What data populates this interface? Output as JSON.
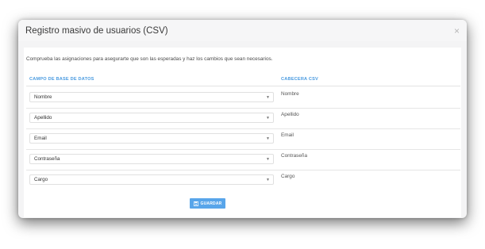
{
  "modal": {
    "title": "Registro masivo de usuarios (CSV)",
    "close": "×"
  },
  "description": "Comprueba las asignaciones para asegurarte que son las esperadas y haz los cambios que sean necesarios.",
  "columns": {
    "db_field": "CAMPO DE BASE DE DATOS",
    "csv_header": "CABECERA CSV"
  },
  "rows": [
    {
      "select": "Nombre",
      "csv": "Nombre"
    },
    {
      "select": "Apellido",
      "csv": "Apellido"
    },
    {
      "select": "Email",
      "csv": "Email"
    },
    {
      "select": "Contraseña",
      "csv": "Contraseña"
    },
    {
      "select": "Cargo",
      "csv": "Cargo"
    }
  ],
  "save_label": "GUARDAR",
  "colors": {
    "accent": "#4a9be0",
    "button": "#58a5ea"
  },
  "icons": {
    "close": "close-icon",
    "caret": "chevron-down-icon",
    "save": "floppy-disk-icon"
  }
}
